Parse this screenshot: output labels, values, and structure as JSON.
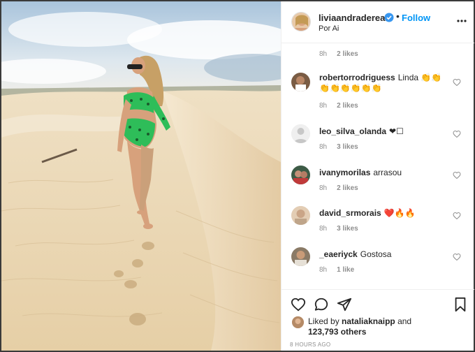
{
  "post": {
    "username": "liviaandradereal",
    "follow_label": "Follow",
    "dot": "•",
    "location": "Por Ai"
  },
  "comments_top_meta": {
    "time": "8h",
    "likes": "2 likes"
  },
  "comments": [
    {
      "username": "robertorrodriguess",
      "text_parts": [
        "Linda",
        "👏👏",
        "👏👏👏👏👏👏"
      ],
      "time": "8h",
      "likes": "2 likes"
    },
    {
      "username": "leo_silva_olanda",
      "text_parts": [
        "❤︎☐"
      ],
      "time": "8h",
      "likes": "3 likes"
    },
    {
      "username": "ivanymorilas",
      "text_parts": [
        "arrasou"
      ],
      "time": "8h",
      "likes": "2 likes"
    },
    {
      "username": "david_srmorais",
      "text_parts": [
        "❤️🔥🔥"
      ],
      "time": "8h",
      "likes": "3 likes"
    },
    {
      "username": "_eaeriyck",
      "text_parts": [
        "Gostosa"
      ],
      "time": "8h",
      "likes": "1 like"
    }
  ],
  "likes": {
    "liked_by_prefix": "Liked by",
    "liked_by_user": "nataliaknaipp",
    "and": "and",
    "count_text": "123,793 others"
  },
  "time_ago": "8 HOURS AGO",
  "colors": {
    "accent": "#0095f6",
    "meta": "#8e8e8e",
    "text": "#262626"
  },
  "icons": [
    "verified-icon",
    "more-icon",
    "heart-icon",
    "comment-icon",
    "share-icon",
    "bookmark-icon"
  ]
}
